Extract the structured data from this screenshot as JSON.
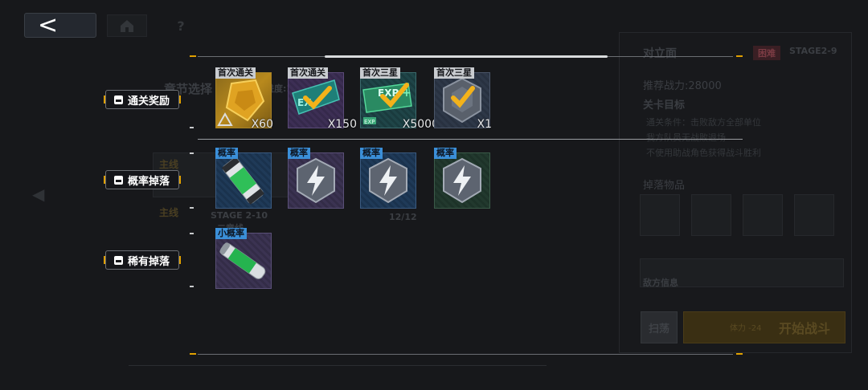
{
  "nav": {
    "back_glyph": "<",
    "home_icon": "home-icon",
    "help_glyph": "?"
  },
  "background": {
    "chapter_select": "章节选择",
    "progress_label": "进度:100",
    "main_line": "主线",
    "stage_code": "STAGE 2-10",
    "stage_name": "二章线",
    "stage_progress": "12/12"
  },
  "right_panel": {
    "title": "对立面",
    "difficulty_tag": "困难",
    "stage": "STAGE2-9",
    "recommended_power": "推荐战力:28000",
    "goal_title": "关卡目标",
    "conditions": [
      "通关条件：击败敌方全部单位",
      "我方队员无战败退场",
      "不使用助战角色获得战斗胜利"
    ],
    "drops_title": "掉落物品",
    "enemy_info": "敌方信息",
    "sweep_label": "扫荡",
    "stamina": "体力 -24",
    "start_label": "开始战斗"
  },
  "rows": [
    {
      "label": "通关奖励",
      "items": [
        {
          "badge": "首次通关",
          "qty": "X60",
          "icon": "gold-crystal-icon",
          "tone": "gold",
          "badge_style": "dark"
        },
        {
          "badge": "首次通关",
          "qty": "X150",
          "icon": "exp-chip-check-icon",
          "tone": "purple",
          "badge_style": "dark"
        },
        {
          "badge": "首次三星",
          "qty": "X5000",
          "icon": "exp-card-check-icon",
          "tone": "teal",
          "badge_style": "dark"
        },
        {
          "badge": "首次三星",
          "qty": "X1",
          "icon": "badge-check-icon",
          "tone": "slate",
          "badge_style": "dark"
        }
      ]
    },
    {
      "label": "概率掉落",
      "items": [
        {
          "badge": "概率",
          "qty": "",
          "icon": "green-canister-icon",
          "tone": "blue",
          "badge_style": "blue"
        },
        {
          "badge": "概率",
          "qty": "",
          "icon": "lightning-emblem-icon",
          "tone": "violet",
          "badge_style": "blue"
        },
        {
          "badge": "概率",
          "qty": "",
          "icon": "lightning-emblem-icon",
          "tone": "blue",
          "badge_style": "blue"
        },
        {
          "badge": "概率",
          "qty": "",
          "icon": "lightning-emblem-icon",
          "tone": "green",
          "badge_style": "blue"
        }
      ]
    },
    {
      "label": "稀有掉落",
      "items": [
        {
          "badge": "小概率",
          "qty": "",
          "icon": "green-tube-icon",
          "tone": "violet",
          "badge_style": "blue"
        }
      ]
    }
  ],
  "colors": {
    "accent": "#e0a000",
    "badge_blue": "#3b8fd8",
    "check": "#f3b21a"
  }
}
